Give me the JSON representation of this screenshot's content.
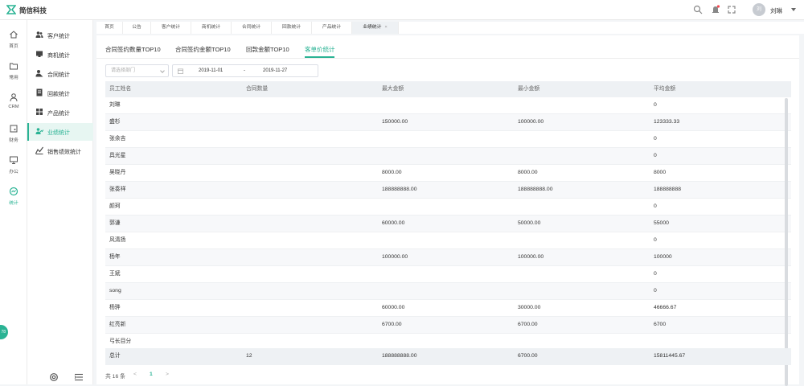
{
  "app": {
    "title": "简信科技",
    "colors": {
      "accent": "#2ab394",
      "header_bg": "#ffffff",
      "page_bg": "#f3f5f7"
    }
  },
  "user": {
    "avatar_text": "刘",
    "name": "刘琳"
  },
  "header_icons": [
    "search-icon",
    "bell-icon",
    "expand-icon"
  ],
  "rail": [
    {
      "label": "首页",
      "icon": "home-icon"
    },
    {
      "label": "常用",
      "icon": "folder-icon"
    },
    {
      "label": "CRM",
      "icon": "user-icon"
    },
    {
      "label": "财务",
      "icon": "wallet-icon"
    },
    {
      "label": "办公",
      "icon": "monitor-icon"
    },
    {
      "label": "统计",
      "icon": "chart-circle-icon",
      "active": true
    }
  ],
  "sidebar": [
    {
      "label": "客户统计",
      "icon": "customers-icon"
    },
    {
      "label": "商机统计",
      "icon": "opportunity-icon"
    },
    {
      "label": "合同统计",
      "icon": "contract-icon"
    },
    {
      "label": "回款统计",
      "icon": "payment-icon"
    },
    {
      "label": "产品统计",
      "icon": "product-icon"
    },
    {
      "label": "业绩统计",
      "icon": "performance-icon",
      "active": true
    },
    {
      "label": "销售绩效统计",
      "icon": "sales-chart-icon"
    }
  ],
  "tabs": [
    {
      "label": "首页"
    },
    {
      "label": "公告"
    },
    {
      "label": "客户统计"
    },
    {
      "label": "商机统计"
    },
    {
      "label": "合同统计"
    },
    {
      "label": "回款统计"
    },
    {
      "label": "产品统计"
    },
    {
      "label": "业绩统计",
      "active": true,
      "close": "×"
    }
  ],
  "subtabs": [
    {
      "label": "合同签约数量TOP10"
    },
    {
      "label": "合同签约金额TOP10"
    },
    {
      "label": "回款金额TOP10"
    },
    {
      "label": "客单价统计",
      "active": true
    }
  ],
  "filters": {
    "department_placeholder": "请选择部门",
    "date_start": "2019-11-01",
    "date_sep": "-",
    "date_end": "2019-11-27"
  },
  "table": {
    "columns": [
      "员工姓名",
      "合同数量",
      "最大金额",
      "最小金额",
      "平均金额"
    ],
    "rows": [
      [
        "刘琳",
        "",
        "",
        "",
        "0"
      ],
      [
        "盛杉",
        "",
        "150000.00",
        "100000.00",
        "123333.33"
      ],
      [
        "张余吉",
        "",
        "",
        "",
        "0"
      ],
      [
        "具光星",
        "",
        "",
        "",
        "0"
      ],
      [
        "吴晓丹",
        "",
        "8000.00",
        "8000.00",
        "8000"
      ],
      [
        "张奏祥",
        "",
        "188888888.00",
        "188888888.00",
        "188888888"
      ],
      [
        "颜珂",
        "",
        "",
        "",
        "0"
      ],
      [
        "郭谦",
        "",
        "60000.00",
        "50000.00",
        "55000"
      ],
      [
        "风清扬",
        "",
        "",
        "",
        "0"
      ],
      [
        "杨年",
        "",
        "100000.00",
        "100000.00",
        "100000"
      ],
      [
        "王斌",
        "",
        "",
        "",
        "0"
      ],
      [
        "song",
        "",
        "",
        "",
        "0"
      ],
      [
        "杨骅",
        "",
        "60000.00",
        "30000.00",
        "46666.67"
      ],
      [
        "红亮新",
        "",
        "6700.00",
        "6700.00",
        "6700"
      ],
      [
        "弓长目分",
        "",
        "",
        "",
        ""
      ]
    ],
    "total": [
      "总计",
      "12",
      "188888888.00",
      "6700.00",
      "15811445.67"
    ]
  },
  "pager": {
    "total_text": "共 16 条",
    "prev": "<",
    "page": "1",
    "next": ">"
  },
  "bubble": "78"
}
